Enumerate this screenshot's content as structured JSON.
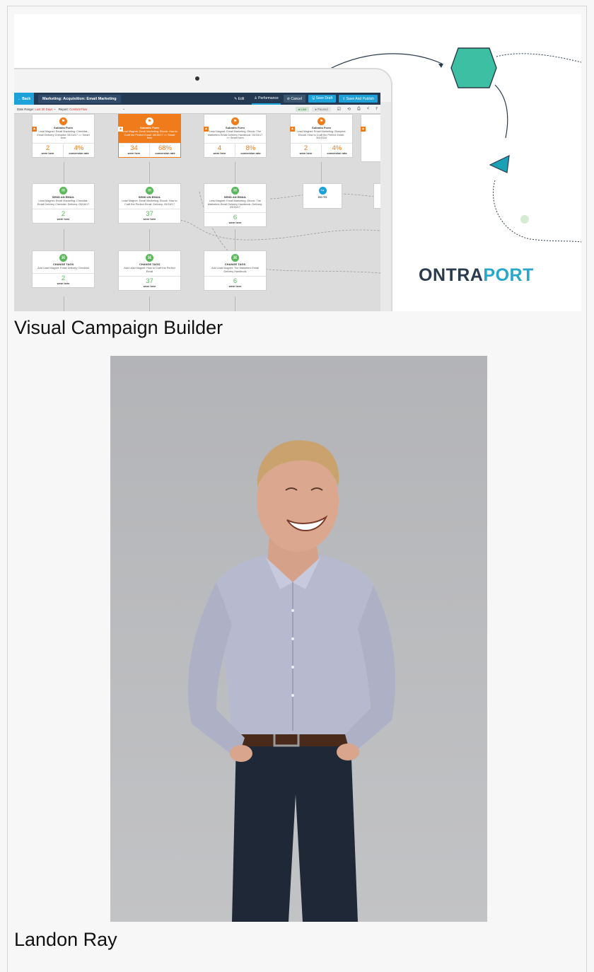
{
  "hero": {
    "app": {
      "back_label": "← Back",
      "campaign_title": "Marketing: Acquisition: Email Marketing",
      "tabs": [
        {
          "label": "✎ Edit"
        },
        {
          "label": "♙ Performance"
        }
      ],
      "cancel_label": "⊘ Cancel",
      "save_draft_label": "🖫 Save Draft",
      "save_publish_label": "⇪ Save And Publish",
      "date_range_label": "Date Range:",
      "date_range_value": "Last 30 Days",
      "report_label": "Report:",
      "report_value": "Contact Flow",
      "live_label": "● Live",
      "paused_label": "● Paused"
    },
    "nodes_row1": [
      {
        "title": "Submits Form",
        "desc": "Lead Magnet: Email Marketing: Checklist: Email Delivery Checklist: 05/16/17 >> Smart form",
        "n1": "2",
        "l1": "were here",
        "n2": "4%",
        "l2": "conversion rate"
      },
      {
        "title": "Submits Form",
        "desc": "Lead Magnet: Email Marketing: Ebook: How to Craft the Perfect Email: 05/16/17 >> Smart form",
        "n1": "34",
        "l1": "were here",
        "n2": "68%",
        "l2": "conversion rate"
      },
      {
        "title": "Submits Form",
        "desc": "Lead Magnet: Email Marketing: Ebook: The Marketers Email Delivery Handbook: 05/16/17 >> Smart form",
        "n1": "4",
        "l1": "were here",
        "n2": "8%",
        "l2": "conversion rate"
      },
      {
        "title": "Submits Form",
        "desc": "Lead Magnet: Email Marketing: Blueprint: Ebook: How to Craft the Perfect Email: 3/4/2016",
        "n1": "2",
        "l1": "were here",
        "n2": "4%",
        "l2": "conversion rate"
      }
    ],
    "nodes_row2": [
      {
        "title": "SEND AN EMAIL",
        "desc": "Lead Magnet: Email Marketing: Checklist: Email Delivery Checklist: Delivery: 05/16/17",
        "n1": "2",
        "l1": "were here"
      },
      {
        "title": "SEND AN EMAIL",
        "desc": "Lead Magnet: Email Marketing: Ebook: How to Craft the Perfect Email: Delivery: 05/16/17",
        "n1": "37",
        "l1": "were here"
      },
      {
        "title": "SEND AN EMAIL",
        "desc": "Lead Magnet: Email Marketing: Ebook: The Marketers Email Delivery Handbook: Delivery: 05/16/17",
        "n1": "6",
        "l1": "were here"
      },
      {
        "title": "GO TO"
      }
    ],
    "nodes_row3": [
      {
        "title": "CHANGE TAGS",
        "desc": "Add Lead Magnet: Email Delivery Checklist",
        "n1": "2",
        "l1": "were here"
      },
      {
        "title": "CHANGE TAGS",
        "desc": "Add Lead Magnet: How to Craft the Perfect Email",
        "n1": "37",
        "l1": "were here"
      },
      {
        "title": "CHANGE TAGS",
        "desc": "Add Lead Magnet: The Marketers Email Delivery Handbook",
        "n1": "6",
        "l1": "were here"
      }
    ],
    "logo_part1": "ONTRA",
    "logo_part2": "PORT",
    "colors": {
      "teal": "#3dbfa4",
      "orange": "#f07b1b",
      "green": "#5cb85c",
      "navy": "#233a52",
      "blue": "#1da1d9"
    }
  },
  "caption1": "Visual Campaign Builder",
  "caption2": "Landon Ray"
}
